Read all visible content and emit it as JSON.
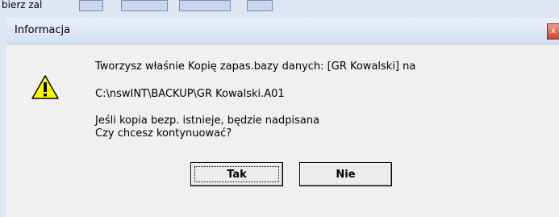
{
  "background": {
    "partial_text": "bierz zal"
  },
  "dialog": {
    "title": "Informacja",
    "close_glyph": "x",
    "icon": "warning-icon",
    "message": {
      "line1": "Tworzysz właśnie Kopię zapas.bazy danych: [GR Kowalski] na",
      "path": "C:\\nswINT\\BACKUP\\GR Kowalski.A01",
      "line3": "Jeśli kopia bezp. istnieje, będzie nadpisana",
      "line4": "Czy chcesz kontynuować?"
    },
    "buttons": {
      "yes": "Tak",
      "no": "Nie"
    }
  },
  "colors": {
    "warning_fill": "#ffff00",
    "close_button": "#c9452b",
    "titlebar": "#dbe5f4"
  }
}
